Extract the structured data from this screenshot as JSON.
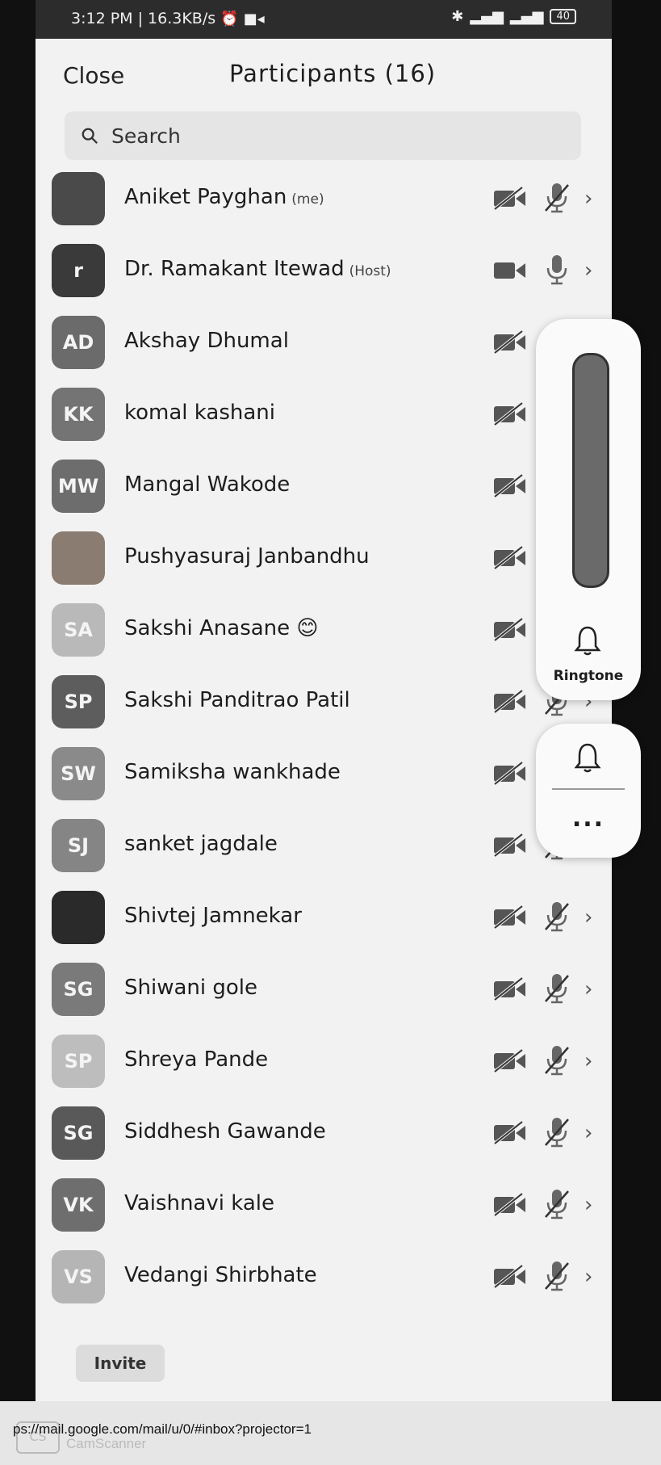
{
  "status_bar": {
    "time_speed": "3:12 PM | 16.3KB/s",
    "battery": "40"
  },
  "header": {
    "close_label": "Close",
    "title": "Participants (16)"
  },
  "search": {
    "placeholder": "Search"
  },
  "participants": [
    {
      "name": "Aniket Payghan",
      "tag": "(me)",
      "initials": "",
      "avatar_color": "#4a4a4a",
      "video_off": true,
      "mic_muted": true
    },
    {
      "name": "Dr. Ramakant Itewad",
      "tag": "(Host)",
      "initials": "r",
      "avatar_color": "#3a3a3a",
      "video_off": false,
      "mic_muted": false
    },
    {
      "name": "Akshay Dhumal",
      "tag": "",
      "initials": "AD",
      "avatar_color": "#6b6b6b",
      "video_off": true,
      "mic_muted": true
    },
    {
      "name": "komal kashani",
      "tag": "",
      "initials": "KK",
      "avatar_color": "#747474",
      "video_off": true,
      "mic_muted": true
    },
    {
      "name": "Mangal Wakode",
      "tag": "",
      "initials": "MW",
      "avatar_color": "#6d6d6d",
      "video_off": true,
      "mic_muted": true
    },
    {
      "name": "Pushyasuraj Janbandhu",
      "tag": "",
      "initials": "",
      "avatar_color": "#8a7c70",
      "video_off": true,
      "mic_muted": true
    },
    {
      "name": "Sakshi Anasane 😊",
      "tag": "",
      "initials": "SA",
      "avatar_color": "#b9b9b9",
      "video_off": true,
      "mic_muted": true
    },
    {
      "name": "Sakshi Panditrao Patil",
      "tag": "",
      "initials": "SP",
      "avatar_color": "#5d5d5d",
      "video_off": true,
      "mic_muted": true
    },
    {
      "name": "Samiksha wankhade",
      "tag": "",
      "initials": "SW",
      "avatar_color": "#8a8a8a",
      "video_off": true,
      "mic_muted": true
    },
    {
      "name": "sanket jagdale",
      "tag": "",
      "initials": "SJ",
      "avatar_color": "#858585",
      "video_off": true,
      "mic_muted": true
    },
    {
      "name": "Shivtej Jamnekar",
      "tag": "",
      "initials": "",
      "avatar_color": "#2a2a2a",
      "video_off": true,
      "mic_muted": true
    },
    {
      "name": "Shiwani gole",
      "tag": "",
      "initials": "SG",
      "avatar_color": "#7a7a7a",
      "video_off": true,
      "mic_muted": true
    },
    {
      "name": "Shreya Pande",
      "tag": "",
      "initials": "SP",
      "avatar_color": "#bdbdbd",
      "video_off": true,
      "mic_muted": true
    },
    {
      "name": "Siddhesh Gawande",
      "tag": "",
      "initials": "SG",
      "avatar_color": "#595959",
      "video_off": true,
      "mic_muted": true
    },
    {
      "name": "Vaishnavi kale",
      "tag": "",
      "initials": "VK",
      "avatar_color": "#6e6e6e",
      "video_off": true,
      "mic_muted": true
    },
    {
      "name": "Vedangi Shirbhate",
      "tag": "",
      "initials": "VS",
      "avatar_color": "#b5b5b5",
      "video_off": true,
      "mic_muted": true
    }
  ],
  "invite_label": "Invite",
  "overlay": {
    "volume_label": "Ringtone",
    "more_label": "..."
  },
  "url_text": "ps://mail.google.com/mail/u/0/#inbox?projector=1",
  "watermark": "CamScanner",
  "icons": {
    "camera": "video-camera-icon",
    "mic": "microphone-icon",
    "chevron": "chevron-right-icon",
    "bell": "bell-icon",
    "search": "search-icon"
  }
}
